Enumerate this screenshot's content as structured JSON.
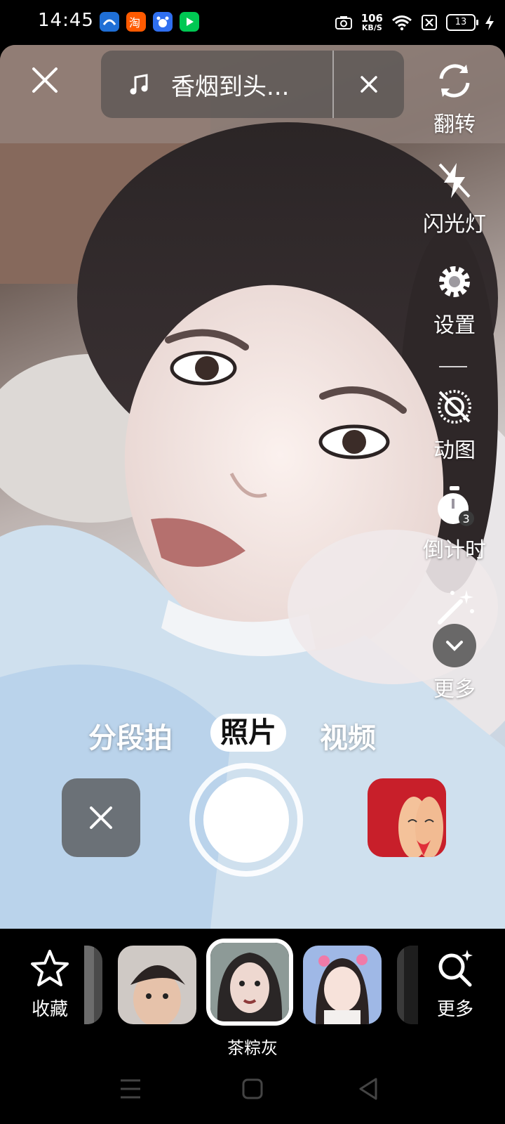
{
  "status_bar": {
    "time": "14:45",
    "net_speed": "106",
    "net_unit": "KB/S",
    "battery": "13",
    "apps": [
      "notification-app-icon",
      "taobao-icon",
      "baidu-icon",
      "iqiyi-icon"
    ]
  },
  "top": {
    "music_title": "香烟到头..."
  },
  "tools": [
    {
      "label": "翻转",
      "icon": "flip-icon"
    },
    {
      "label": "闪光灯",
      "icon": "flash-off-icon"
    },
    {
      "label": "设置",
      "icon": "settings-gear-icon"
    },
    {
      "label": "动图",
      "icon": "live-photo-off-icon"
    },
    {
      "label": "倒计时",
      "icon": "timer-icon",
      "badge": "3"
    },
    {
      "label": "更多",
      "icon": "chevron-down-icon"
    }
  ],
  "modes": [
    "分段拍",
    "照片",
    "视频"
  ],
  "active_mode": "照片",
  "filters": {
    "favorite_label": "收藏",
    "more_label": "更多",
    "selected_name": "茶粽灰"
  },
  "colors": {
    "accent": "#ffffff",
    "background": "#000000"
  }
}
